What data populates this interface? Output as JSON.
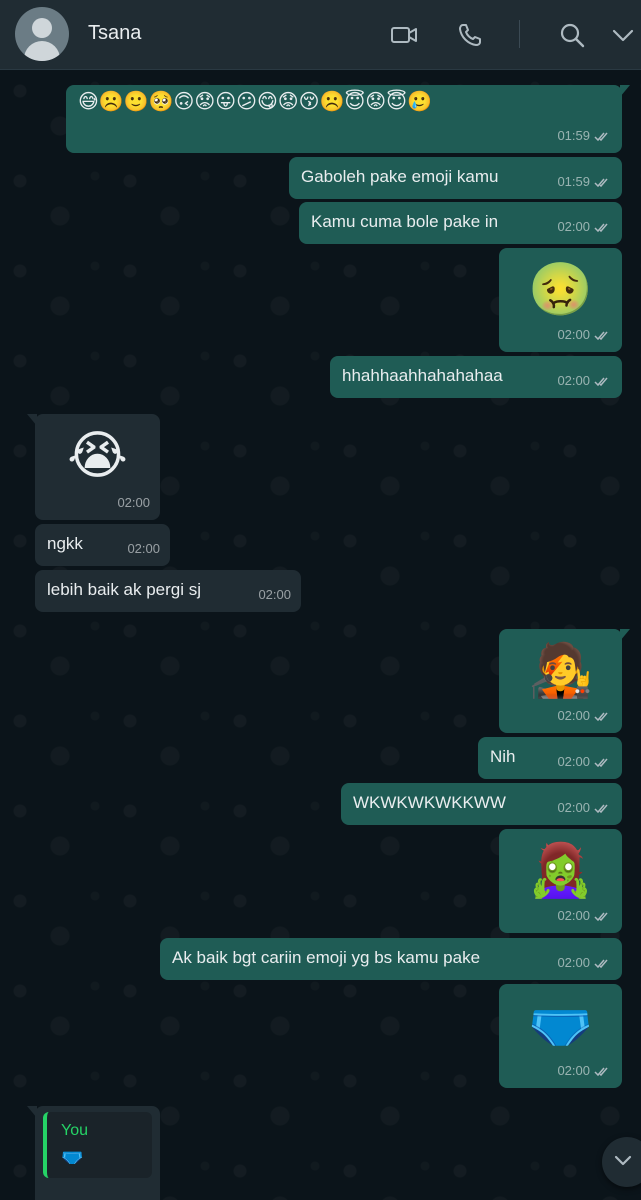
{
  "header": {
    "contact_name": "Tsana",
    "icons": [
      "video-call-icon",
      "voice-call-icon",
      "search-icon",
      "chevron-down-icon"
    ]
  },
  "messages": [
    {
      "dir": "out",
      "type": "emoji-row",
      "content": "😅☹️🙂🥺🙃😟😛😕😋😟😚☹️😇😟😇🥲",
      "time": "01:59",
      "status": "read"
    },
    {
      "dir": "out",
      "type": "text",
      "text": "Gaboleh pake emoji kamu",
      "time": "01:59",
      "status": "read"
    },
    {
      "dir": "out",
      "type": "text",
      "text": "Kamu cuma bole pake in",
      "time": "02:00",
      "status": "read"
    },
    {
      "dir": "out",
      "type": "emoji",
      "emoji": "🤢",
      "time": "02:00",
      "status": "read"
    },
    {
      "dir": "out",
      "type": "text",
      "text": "hhahhaahhahahahaa",
      "time": "02:00",
      "status": "read"
    },
    {
      "dir": "in",
      "type": "emoji",
      "emoji": "😭",
      "time": "02:00"
    },
    {
      "dir": "in",
      "type": "text",
      "text": "ngkk",
      "time": "02:00"
    },
    {
      "dir": "in",
      "type": "text",
      "text": "lebih baik ak pergi sj",
      "time": "02:00"
    },
    {
      "dir": "out",
      "type": "emoji",
      "emoji": "🧑‍🎤",
      "time": "02:00",
      "status": "read"
    },
    {
      "dir": "out",
      "type": "text",
      "text": "Nih",
      "time": "02:00",
      "status": "read"
    },
    {
      "dir": "out",
      "type": "text",
      "text": "WKWKWKWKKWW",
      "time": "02:00",
      "status": "read"
    },
    {
      "dir": "out",
      "type": "emoji",
      "emoji": "🧟‍♀️",
      "time": "02:00",
      "status": "read"
    },
    {
      "dir": "out",
      "type": "text",
      "text": "Ak baik bgt cariin emoji yg bs kamu pake",
      "time": "02:00",
      "status": "read"
    },
    {
      "dir": "out",
      "type": "emoji",
      "emoji": "🩲",
      "time": "02:00",
      "status": "read"
    },
    {
      "dir": "in",
      "type": "reply",
      "reply_author": "You",
      "reply_preview": "🩲"
    }
  ],
  "colors": {
    "header_bg": "#202c33",
    "chat_bg": "#0b141a",
    "outgoing_bubble": "#1f5c55",
    "incoming_bubble": "#202c33",
    "read_ticks": "#aebac1",
    "reply_accent": "#25d366"
  }
}
